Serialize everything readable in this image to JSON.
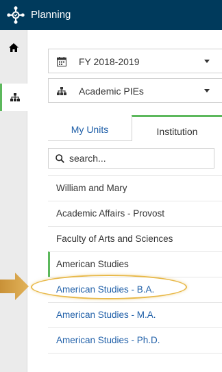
{
  "header": {
    "app_title": "Planning",
    "background_color": "#003a5c",
    "logo_icon": "network-logo-icon"
  },
  "rail": {
    "items": [
      {
        "name": "home",
        "icon": "home-icon",
        "active": false
      },
      {
        "name": "org-hierarchy",
        "icon": "sitemap-icon",
        "active": true
      }
    ]
  },
  "filters": {
    "fiscal_year": {
      "icon": "calendar-icon",
      "selected": "FY 2018-2019"
    },
    "pie_set": {
      "icon": "sitemap-icon",
      "selected": "Academic PIEs"
    }
  },
  "tabs": [
    {
      "label": "My Units",
      "active": false
    },
    {
      "label": "Institution",
      "active": true
    }
  ],
  "search": {
    "placeholder": "search...",
    "value": ""
  },
  "units": [
    {
      "label": "William and Mary",
      "style": "default"
    },
    {
      "label": "Academic Affairs - Provost",
      "style": "default"
    },
    {
      "label": "Faculty of Arts and Sciences",
      "style": "default"
    },
    {
      "label": "American Studies",
      "style": "selected"
    },
    {
      "label": "American Studies - B.A.",
      "style": "link",
      "highlighted": true
    },
    {
      "label": "American Studies - M.A.",
      "style": "link"
    },
    {
      "label": "American Studies - Ph.D.",
      "style": "link"
    }
  ],
  "colors": {
    "accent_green": "#5cb85c",
    "link_blue": "#1f5fa8",
    "highlight_gold": "#e8b94a",
    "arrow_gold": "#d9a441"
  }
}
